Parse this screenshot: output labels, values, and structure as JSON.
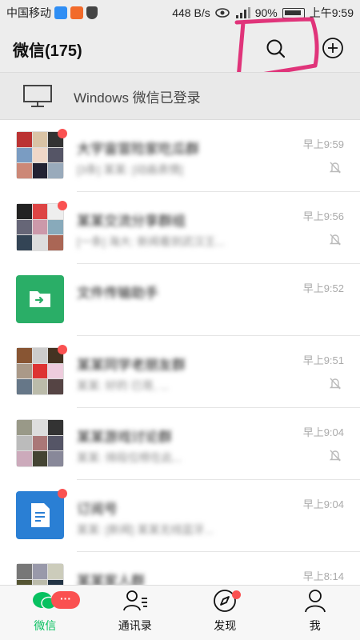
{
  "statusbar": {
    "carrier": "中国移动",
    "speed": "448 B/s",
    "battery": "90%",
    "clock": "上午9:59"
  },
  "header": {
    "title": "微信(175)"
  },
  "banner": {
    "label": "Windows 微信已登录"
  },
  "chats": [
    {
      "name": "大宇宙冒险家吃瓜群",
      "preview": "[3条] 某某: [动画表情]",
      "time": "早上9:59",
      "muted": true,
      "unread": true,
      "avatar": "group"
    },
    {
      "name": "某某交流分享群组",
      "preview": "[一条] 海大: 新闻看到武汉王...",
      "time": "早上9:56",
      "muted": true,
      "unread": true,
      "avatar": "group"
    },
    {
      "name": "文件传输助手",
      "preview": "",
      "time": "早上9:52",
      "muted": false,
      "unread": false,
      "avatar": "file"
    },
    {
      "name": "某某同学老朋友群",
      "preview": "某某: 好的 已哥, ...",
      "time": "早上9:51",
      "muted": true,
      "unread": true,
      "avatar": "group"
    },
    {
      "name": "某某游戏讨论群",
      "preview": "某某: 排段位榜在此...",
      "time": "早上9:04",
      "muted": true,
      "unread": false,
      "avatar": "group"
    },
    {
      "name": "订阅号",
      "preview": "某某: [新闻] 某某无线蓝牙...",
      "time": "早上9:04",
      "muted": false,
      "unread": true,
      "avatar": "subscription"
    },
    {
      "name": "某某家人群",
      "preview": "",
      "time": "早上8:14",
      "muted": false,
      "unread": false,
      "avatar": "group"
    }
  ],
  "tabs": [
    {
      "label": "微信",
      "badge": "···",
      "active": true
    },
    {
      "label": "通讯录",
      "active": false
    },
    {
      "label": "发现",
      "dot": true,
      "active": false
    },
    {
      "label": "我",
      "active": false
    }
  ],
  "colors": {
    "accent": "#07c160",
    "badge": "#fa5151",
    "annotation": "#e0347a"
  }
}
